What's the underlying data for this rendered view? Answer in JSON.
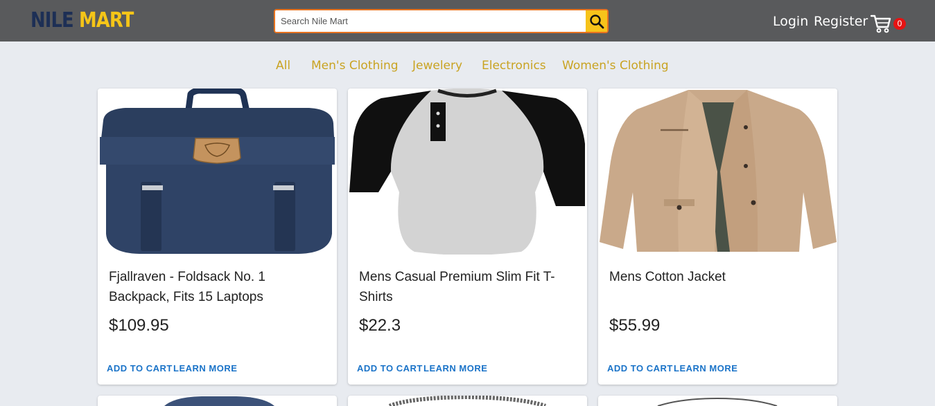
{
  "header": {
    "logo_part1": "NILE",
    "logo_part2": "MART",
    "search_placeholder": "Search Nile Mart",
    "search_icon": "magnifier-icon",
    "login_label": "Login",
    "register_label": "Register",
    "cart_icon": "shopping-cart-icon",
    "cart_count": "0"
  },
  "categories": [
    "All",
    "Men's Clothing",
    "Jewelery",
    "Electronics",
    "Women's Clothing"
  ],
  "products": [
    {
      "title": "Fjallraven - Foldsack No. 1 Backpack, Fits 15 Laptops",
      "price": "$109.95",
      "add_label": "ADD TO CART",
      "learn_label": "LEARN MORE"
    },
    {
      "title": "Mens Casual Premium Slim Fit T-Shirts",
      "price": "$22.3",
      "add_label": "ADD TO CART",
      "learn_label": "LEARN MORE"
    },
    {
      "title": "Mens Cotton Jacket",
      "price": "$55.99",
      "add_label": "ADD TO CART",
      "learn_label": "LEARN MORE"
    }
  ],
  "colors": {
    "header_bg": "#595a5c",
    "accent_gold": "#c9a322",
    "link_blue": "#1a73c8",
    "badge_red": "#e51313"
  }
}
